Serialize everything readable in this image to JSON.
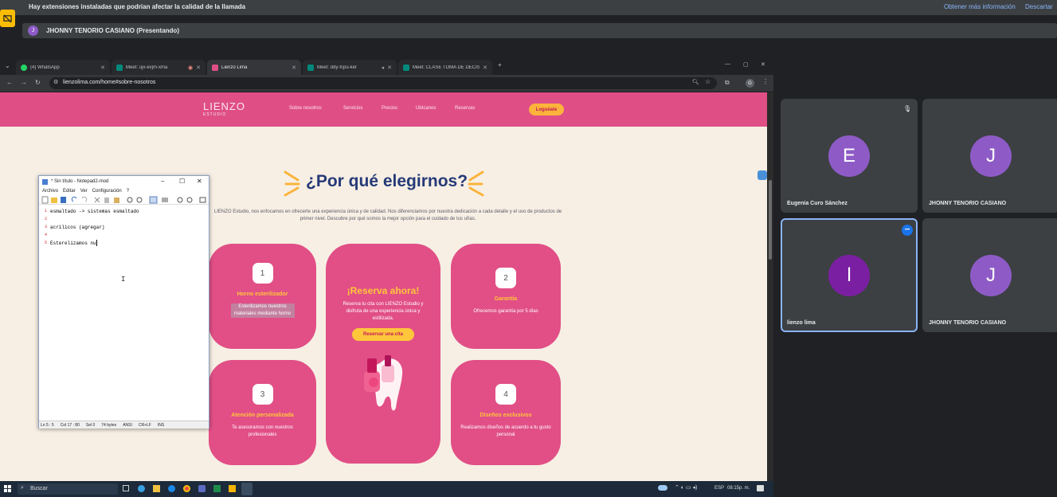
{
  "meet": {
    "warning_text": "Hay extensiones instaladas que podrían afectar la calidad de la llamada",
    "more_info": "Obtener más información",
    "dismiss": "Descartar",
    "presenter_initial": "J",
    "presenter_text": "JHONNY TENORIO CASIANO (Presentando)"
  },
  "browser": {
    "tabs": [
      {
        "label": "(4) WhatsApp",
        "color": "#25d366"
      },
      {
        "label": "Meet: ujx-evjm-xma",
        "color": "#00897b"
      },
      {
        "label": "Lienzo Lima",
        "color": "#df4f86"
      },
      {
        "label": "Meet: ddy-fcpu-ker",
        "color": "#00897b"
      },
      {
        "label": "Meet: CLASE TOMA DE DECISIO...",
        "color": "#00897b"
      }
    ],
    "url": "lienzolima.com/home#sobre-nosotros",
    "profile_initial": "G"
  },
  "site": {
    "logo": "LIENZO",
    "logo_sub": "ESTUDIO",
    "nav": [
      "Sobre nosotros",
      "Servicios",
      "Precios",
      "Ubícanos",
      "Reservas"
    ],
    "login": "Loguéate",
    "heading": "¿Por qué elegirnos?",
    "intro": "LIENZO Estudio, nos enfocamos en ofrecerte una experiencia única y de calidad. Nos diferenciamos por nuestra dedicación a cada detalle y el uso de productos de primer nivel. Descubre por qué somos la mejor opción para el cuidado de tus uñas.",
    "cards": [
      {
        "num": "1",
        "title": "Horno esterilizador",
        "text": "Esterilizamos nuestros materiales mediante horno"
      },
      {
        "num": "2",
        "title": "Garantía",
        "text": "Ofrecemos garantía por 5 días"
      },
      {
        "num": "3",
        "title": "Atención personalizada",
        "text": "Te asesoramos con nuestros profesionales"
      },
      {
        "num": "4",
        "title": "Diseños exclusivos",
        "text": "Realizamos diseños de acuerdo a tu gusto personal"
      }
    ],
    "reserve": {
      "title": "¡Reserva ahora!",
      "text": "Reserva tu cita con LIENZO Estudio y disfruta de una experiencia única y estilizada.",
      "button": "Reservar una cita"
    }
  },
  "notepad": {
    "title": "* Sin título - Notepad2-mod",
    "menu": [
      "Archivo",
      "Editar",
      "Ver",
      "Configuración",
      "?"
    ],
    "lines": [
      {
        "n": "1",
        "text": "esmaltado -> sistemas esmaltado"
      },
      {
        "n": "2",
        "text": ""
      },
      {
        "n": "3",
        "text": "acrilicos (agregar)"
      },
      {
        "n": "4",
        "text": ""
      },
      {
        "n": "5",
        "text": "Esterelizamos nu"
      }
    ],
    "status": [
      "Ln 5 : 5",
      "Col 17 : 80",
      "Sel 0",
      "74 bytes",
      "ANSI",
      "CR+LF",
      "INS"
    ]
  },
  "taskbar": {
    "search": "Buscar",
    "lang": "ESP",
    "time": "08:15p. m."
  },
  "participants": [
    {
      "initial": "E",
      "name": "Eugenia Curo Sánchez",
      "color": "#8e5bc6"
    },
    {
      "initial": "J",
      "name": "JHONNY TENORIO CASIANO",
      "color": "#8e5bc6"
    },
    {
      "initial": "l",
      "name": "lienzo lima",
      "color": "#7b1fa2"
    },
    {
      "initial": "J",
      "name": "JHONNY TENORIO CASIANO",
      "color": "#8e5bc6"
    }
  ]
}
